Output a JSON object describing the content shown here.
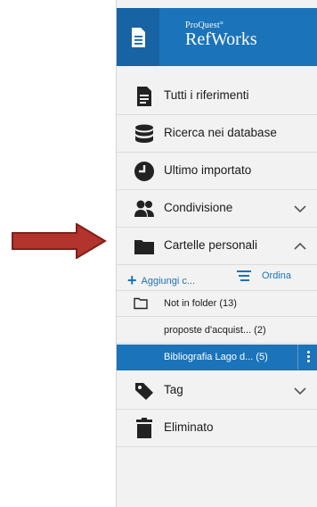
{
  "header": {
    "brand_small": "ProQuest°",
    "brand_big": "RefWorks"
  },
  "nav": {
    "all_refs": "Tutti i riferimenti",
    "db_search": "Ricerca nei database",
    "last_import": "Ultimo importato",
    "sharing": "Condivisione",
    "my_folders": "Cartelle personali",
    "tags": "Tag",
    "deleted": "Eliminato"
  },
  "folders_toolbar": {
    "add_label": "Aggiungi c...",
    "sort_label": "Ordina"
  },
  "folders": [
    {
      "label": "Not in folder (13)"
    },
    {
      "label": "proposte d'acquist...  (2)"
    },
    {
      "label": "Bibliografia Lago d...  (5)"
    }
  ],
  "colors": {
    "brand_blue": "#1b73b9",
    "arrow_red": "#b3342c"
  }
}
